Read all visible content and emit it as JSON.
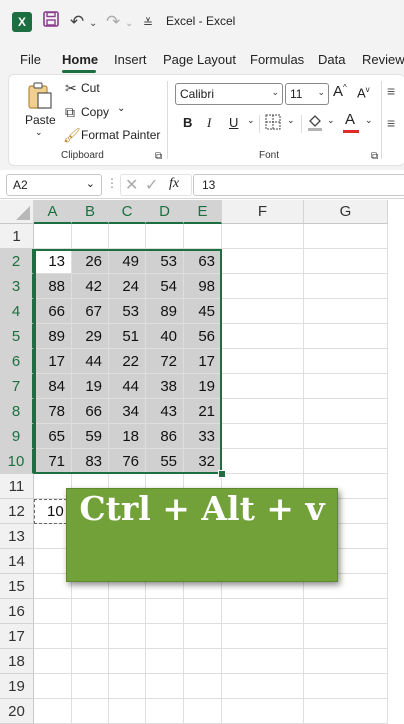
{
  "titlebar": {
    "app_title": "Excel  -  Excel",
    "icons": [
      "excel-logo-icon",
      "save-icon",
      "undo-icon",
      "redo-icon",
      "customize-qat-icon"
    ]
  },
  "tabs": [
    {
      "label": "File",
      "active": false
    },
    {
      "label": "Home",
      "active": true
    },
    {
      "label": "Insert",
      "active": false
    },
    {
      "label": "Page Layout",
      "active": false
    },
    {
      "label": "Formulas",
      "active": false
    },
    {
      "label": "Data",
      "active": false
    },
    {
      "label": "Review",
      "active": false
    }
  ],
  "ribbon": {
    "paste_label": "Paste",
    "cut_label": "Cut",
    "copy_label": "Copy",
    "format_painter_label": "Format Painter",
    "clipboard_group": "Clipboard",
    "font_name": "Calibri",
    "font_size": "11",
    "bold": "B",
    "italic": "I",
    "underline": "U",
    "font_color_glyph": "A",
    "font_group": "Font",
    "grow_font_glyph": "A",
    "shrink_font_glyph": "A"
  },
  "formula_bar": {
    "name_box": "A2",
    "fx": "fx",
    "value": "13"
  },
  "sheet": {
    "columns": [
      "A",
      "B",
      "C",
      "D",
      "E",
      "F",
      "G"
    ],
    "selected_columns": [
      "A",
      "B",
      "C",
      "D",
      "E"
    ],
    "rows": [
      "1",
      "2",
      "3",
      "4",
      "5",
      "6",
      "7",
      "8",
      "9",
      "10",
      "11",
      "12",
      "13",
      "14",
      "15",
      "16",
      "17",
      "18",
      "19",
      "20"
    ],
    "selected_rows": [
      "2",
      "3",
      "4",
      "5",
      "6",
      "7",
      "8",
      "9",
      "10"
    ],
    "data": [
      [
        "13",
        "26",
        "49",
        "53",
        "63"
      ],
      [
        "88",
        "42",
        "24",
        "54",
        "98"
      ],
      [
        "66",
        "67",
        "53",
        "89",
        "45"
      ],
      [
        "89",
        "29",
        "51",
        "40",
        "56"
      ],
      [
        "17",
        "44",
        "22",
        "72",
        "17"
      ],
      [
        "84",
        "19",
        "44",
        "38",
        "19"
      ],
      [
        "78",
        "66",
        "34",
        "43",
        "21"
      ],
      [
        "65",
        "59",
        "18",
        "86",
        "33"
      ],
      [
        "71",
        "83",
        "76",
        "55",
        "32"
      ]
    ],
    "a12": "10"
  },
  "banner": {
    "text": "Ctrl + Alt + v",
    "color": "#72a13a"
  },
  "colors": {
    "accent": "#1d6f42",
    "selection": "#d0d0d0"
  }
}
